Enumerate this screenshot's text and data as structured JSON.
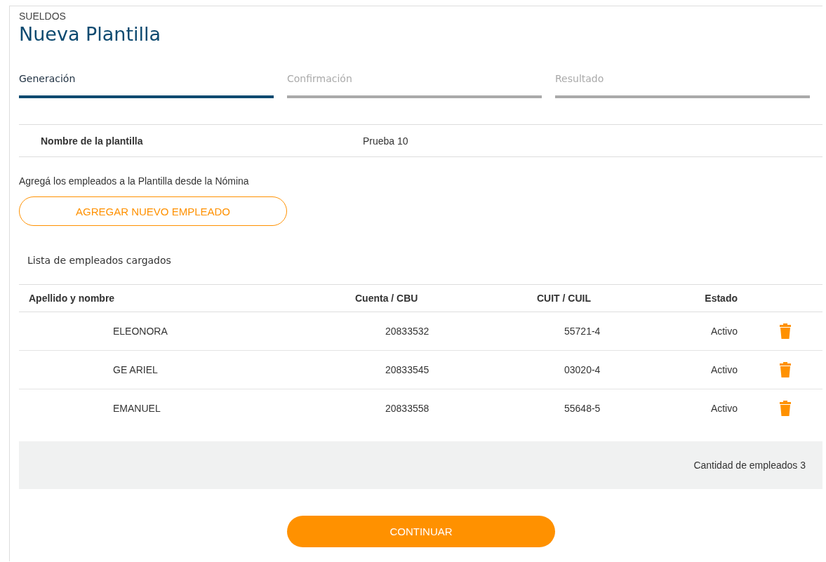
{
  "header": {
    "section": "SUELDOS",
    "title": "Nueva Plantilla"
  },
  "steps": [
    {
      "label": "Generación",
      "selected": true
    },
    {
      "label": "Confirmación",
      "selected": false
    },
    {
      "label": "Resultado",
      "selected": false
    }
  ],
  "template": {
    "label": "Nombre de la plantilla",
    "value": "Prueba 10"
  },
  "instructions": "Agregá los empleados a la Plantilla desde la Nómina",
  "add_button": "AGREGAR NUEVO EMPLEADO",
  "list_title": "Lista de empleados cargados",
  "table": {
    "columns": [
      "Apellido y nombre",
      "Cuenta / CBU",
      "CUIT / CUIL",
      "Estado"
    ],
    "rows": [
      {
        "name": "ELEONORA",
        "account": "20833532",
        "cuit": "55721-4",
        "status": "Activo"
      },
      {
        "name": "GE ARIEL",
        "account": "20833545",
        "cuit": "03020-4",
        "status": "Activo"
      },
      {
        "name": "EMANUEL",
        "account": "20833558",
        "cuit": "55648-5",
        "status": "Activo"
      }
    ]
  },
  "footer": "Cantidad de empleados 3",
  "continue_button": "CONTINUAR"
}
